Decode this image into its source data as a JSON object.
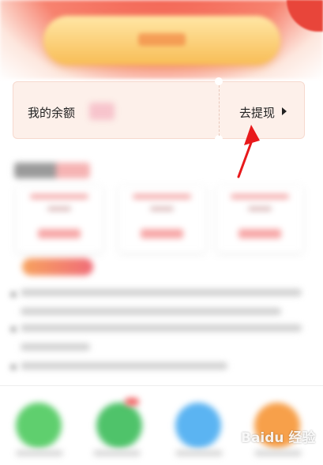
{
  "header": {
    "cta_label": ""
  },
  "balance_card": {
    "label": "我的余额",
    "value": "",
    "withdraw_label": "去提现"
  },
  "watermark": {
    "text": "Baidu 经验"
  },
  "colors": {
    "accent_red": "#e8453a",
    "card_bg": "#fdf0ea",
    "cta_gold": "#f8bd56",
    "annotation_arrow": "#e8191b"
  },
  "icons": {
    "withdraw_arrow": "caret-right-icon",
    "nav_1": "phone-icon",
    "nav_2": "phone-icon",
    "nav_3": "globe-icon",
    "nav_4": "more-icon"
  }
}
